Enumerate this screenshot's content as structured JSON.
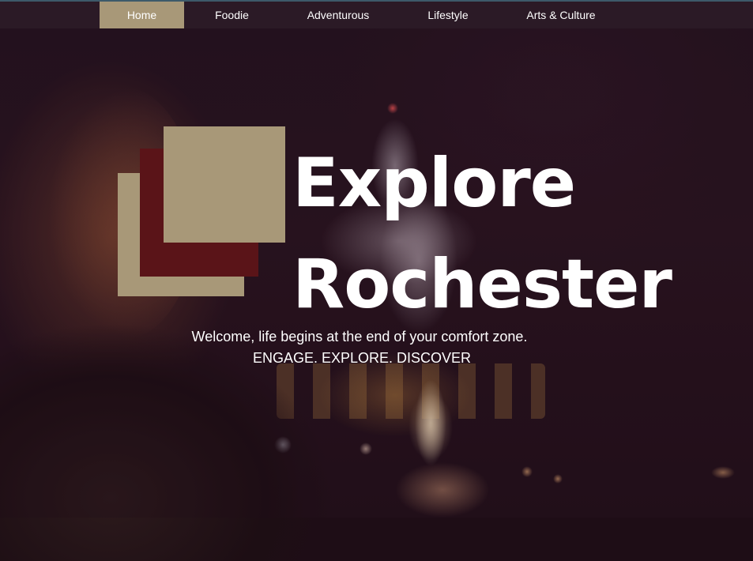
{
  "nav": {
    "items": [
      {
        "label": "Home",
        "active": true
      },
      {
        "label": "Foodie",
        "active": false
      },
      {
        "label": "Adventurous",
        "active": false
      },
      {
        "label": "Lifestyle",
        "active": false
      },
      {
        "label": "Arts & Culture",
        "active": false
      }
    ]
  },
  "hero": {
    "title_line1": "Explore",
    "title_line2": "Rochester",
    "tagline": "Welcome, life begins at the end of your comfort zone.",
    "motto": "ENGAGE. EXPLORE. DISCOVER"
  },
  "colors": {
    "accent_tan": "#a89878",
    "accent_maroon": "#5a1418",
    "nav_bg": "#2b1a26"
  }
}
